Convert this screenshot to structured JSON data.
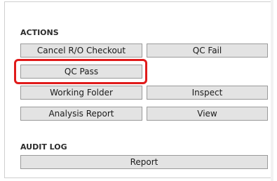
{
  "actions": {
    "title": "ACTIONS",
    "cancel_checkout": "Cancel R/O Checkout",
    "qc_fail": "QC Fail",
    "qc_pass": "QC Pass",
    "working_folder": "Working Folder",
    "inspect": "Inspect",
    "analysis_report": "Analysis Report",
    "view": "View"
  },
  "audit_log": {
    "title": "AUDIT LOG",
    "report": "Report"
  },
  "colors": {
    "button_bg": "#e3e3e3",
    "button_border": "#9a9a9a",
    "highlight": "#e01b1b"
  }
}
